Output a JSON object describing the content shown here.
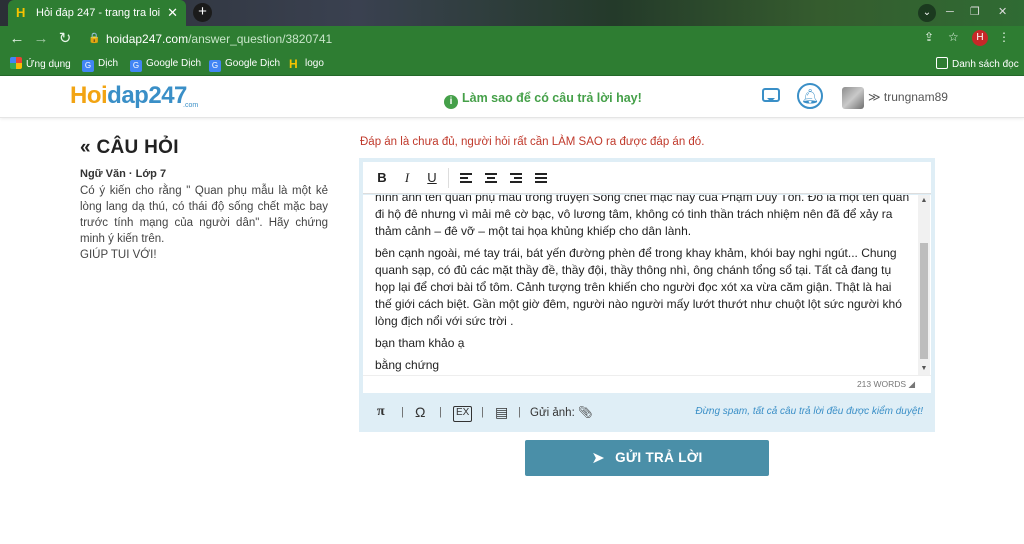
{
  "browser": {
    "tab_title": "Hỏi đáp 247 - trang tra loi",
    "tab_favicon": "H",
    "url_host": "hoidap247.com",
    "url_path": "/answer_question/3820741",
    "profile_initial": "H",
    "bookmarks": [
      {
        "label": "Ứng dụng",
        "icon": "apps-grid-icon"
      },
      {
        "label": "Dịch",
        "icon": "google-translate-icon"
      },
      {
        "label": "Google Dịch",
        "icon": "google-translate-icon"
      },
      {
        "label": "Google Dịch",
        "icon": "google-translate-icon"
      },
      {
        "label": "logo",
        "icon": "hoidap-favicon"
      }
    ],
    "reading_list": "Danh sách đọc"
  },
  "site": {
    "logo_part1": "Hoi",
    "logo_part2": "dap247",
    "logo_sub": ".com",
    "hint": "Làm sao để có câu trả lời hay!",
    "username": "trungnam89",
    "accent": "#3a8fc7",
    "brand_green": "#2e7d32"
  },
  "question": {
    "heading": "CÂU HỎI",
    "meta": "Ngữ Văn · Lớp 7",
    "body": "Có ý kiến cho rằng \" Quan phụ mẫu là một kẻ lòng lang dạ thú, có thái độ sống chết mặc bay trước tính mạng của người dân\". Hãy chứng minh ý kiến trên.",
    "body2": "GIÚP TUI VỚI!"
  },
  "answer": {
    "notice": "Đáp án là chưa đủ, người hỏi rất cần LÀM SAO ra được đáp án đó.",
    "toolbar": {
      "bold": "B",
      "italic": "I",
      "underline": "U"
    },
    "paragraphs": [
      "hình ảnh tên quan phụ mẫu trong truyện Sống chết mặc hay của Phạm Duy Tốn. Đó là một tên quan đi hộ đê nhưng vì mải mê cờ bạc, vô lương tâm, không có tinh thần trách nhiệm nên đã để xảy ra thảm cảnh – đê vỡ – một tai họa khủng khiếp cho dân lành.",
      "bên cạnh ngoài, mé tay trái, bát yến đường phèn để trong khay khảm, khói bay nghi ngút... Chung quanh sạp, có đủ các mặt thầy đề, thầy đội, thầy thông nhì, ông chánh tổng sổ tại. Tất cả đang tụ họp lại để chơi bài tổ tôm. Cảnh tượng trên khiến cho người đọc xót xa vừa căm giận. Thật là hai thế giới cách biệt. Gần một giờ đêm, người nào người mấy lướt thướt như chuột lột sức người khó lòng địch nổi với sức trời .",
      "bạn tham khảo ạ",
      "bằng chứng"
    ],
    "word_count": "213 WORDS",
    "upload_label": "Gửi ảnh:",
    "spam_note": "Đừng spam, tất cả câu trả lời đều được kiểm duyệt!",
    "submit_label": "GỬI TRẢ LỜI"
  }
}
